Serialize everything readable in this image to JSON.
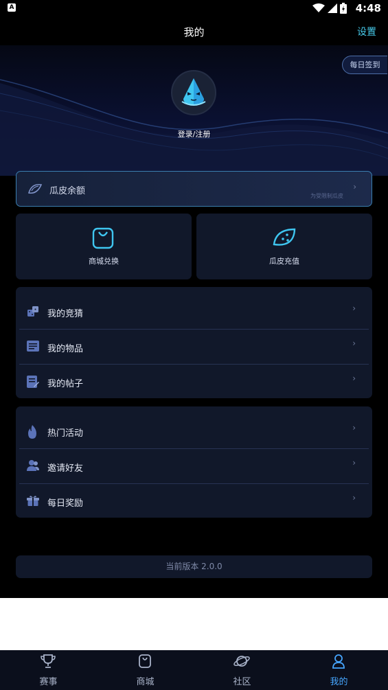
{
  "status_bar": {
    "time": "4:48",
    "app_badge": "A"
  },
  "header": {
    "title": "我的",
    "settings": "设置"
  },
  "hero": {
    "checkin": "每日签到",
    "login": "登录/注册"
  },
  "balance": {
    "label": "瓜皮余额",
    "note": "为受限制瓜皮",
    "chevron": "›"
  },
  "tiles": [
    {
      "label": "商城兑换",
      "icon": "shopping-bag-icon"
    },
    {
      "label": "瓜皮充值",
      "icon": "watermelon-icon"
    }
  ],
  "menu_group_1": [
    {
      "label": "我的竞猜",
      "icon": "dice-icon"
    },
    {
      "label": "我的物品",
      "icon": "list-icon"
    },
    {
      "label": "我的帖子",
      "icon": "post-icon"
    }
  ],
  "menu_group_2": [
    {
      "label": "热门活动",
      "icon": "flame-icon"
    },
    {
      "label": "邀请好友",
      "icon": "friends-icon"
    },
    {
      "label": "每日奖励",
      "icon": "gift-icon"
    }
  ],
  "chevron": "›",
  "version": "当前版本 2.0.0",
  "tabbar": [
    {
      "label": "赛事",
      "icon": "trophy-icon"
    },
    {
      "label": "商城",
      "icon": "bag-icon"
    },
    {
      "label": "社区",
      "icon": "planet-icon"
    },
    {
      "label": "我的",
      "icon": "person-icon",
      "active": true
    }
  ],
  "colors": {
    "accent": "#46c8e8",
    "active_tab": "#46a6ff",
    "card_bg": "#11182a"
  }
}
